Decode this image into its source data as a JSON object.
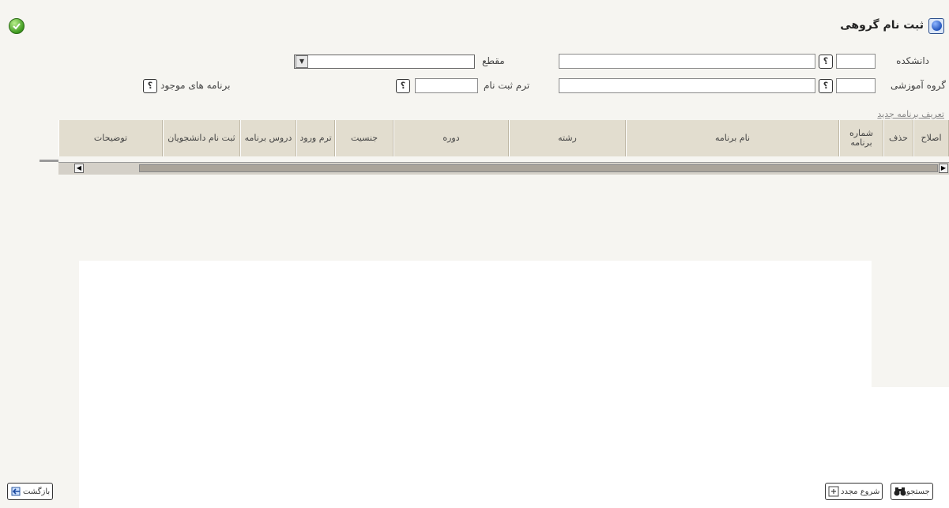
{
  "page": {
    "title": "ثبت نام گروهی"
  },
  "filters": {
    "faculty_label": "دانشکده",
    "level_label": "مقطع",
    "edu_group_label": "گروه آموزشی",
    "term_label": "ترم ثبت نام",
    "existing_programs_label": "برنامه های موجود",
    "lookup_symbol": "؟",
    "faculty_code": "",
    "faculty_name": "",
    "group_code": "",
    "group_name": "",
    "term": "",
    "level": ""
  },
  "links": {
    "new_program": "تعریف برنامه جدید"
  },
  "grid": {
    "columns": [
      "اصلاح",
      "حذف",
      "شماره برنامه",
      "نام برنامه",
      "رشته",
      "دوره",
      "جنسیت",
      "ترم ورود",
      "دروس برنامه",
      "ثبت نام دانشجویان",
      "توضیحات"
    ]
  },
  "buttons": {
    "search": "جستجو",
    "restart": "شروع مجدد",
    "back": "بازگشت"
  },
  "icons": {
    "status": "check-circle-icon",
    "help": "help-icon",
    "search": "binoculars-icon",
    "restart": "restart-icon",
    "back": "back-arrow-icon"
  }
}
